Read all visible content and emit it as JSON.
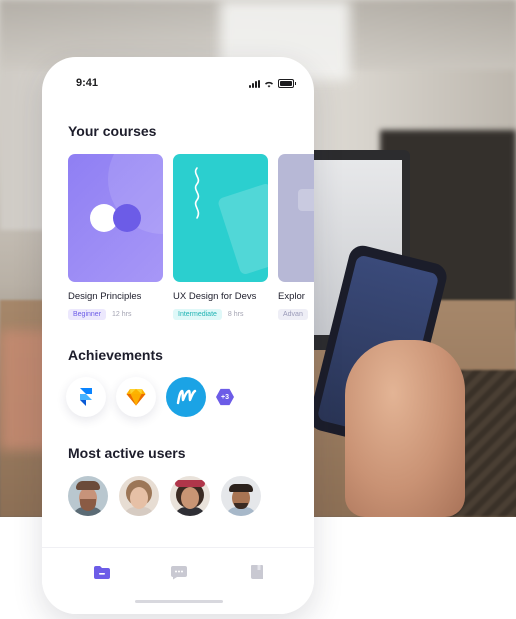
{
  "status_bar": {
    "time": "9:41"
  },
  "sections": {
    "courses_title": "Your courses",
    "achievements_title": "Achievements",
    "users_title": "Most active users"
  },
  "courses": [
    {
      "name": "Design Principles",
      "level": "Beginner",
      "hours": "12 hrs",
      "color": "#9c8cf5",
      "badge_bg": "#ece8fd",
      "badge_fg": "#6c5ce7"
    },
    {
      "name": "UX Design for Devs",
      "level": "Intermediate",
      "hours": "8 hrs",
      "color": "#2bcfcf",
      "badge_bg": "#dff8f8",
      "badge_fg": "#22b3b3"
    },
    {
      "name": "Explor",
      "level": "Advan",
      "hours": "",
      "color": "#b7b8d6",
      "badge_bg": "#eeeef6",
      "badge_fg": "#9a9ab8"
    }
  ],
  "achievements": {
    "items": [
      {
        "icon": "framer-icon"
      },
      {
        "icon": "sketch-icon"
      },
      {
        "icon": "marvel-icon"
      }
    ],
    "more_label": "+3"
  },
  "users": [
    {
      "avatar": "avatar-1"
    },
    {
      "avatar": "avatar-2"
    },
    {
      "avatar": "avatar-3"
    },
    {
      "avatar": "avatar-4"
    }
  ],
  "tabbar": {
    "items": [
      {
        "icon": "folder-icon",
        "active": true
      },
      {
        "icon": "chat-icon",
        "active": false
      },
      {
        "icon": "book-icon",
        "active": false
      }
    ]
  },
  "colors": {
    "accent": "#6c5ce7",
    "teal": "#2bcfcf",
    "text": "#1d1d2b"
  }
}
